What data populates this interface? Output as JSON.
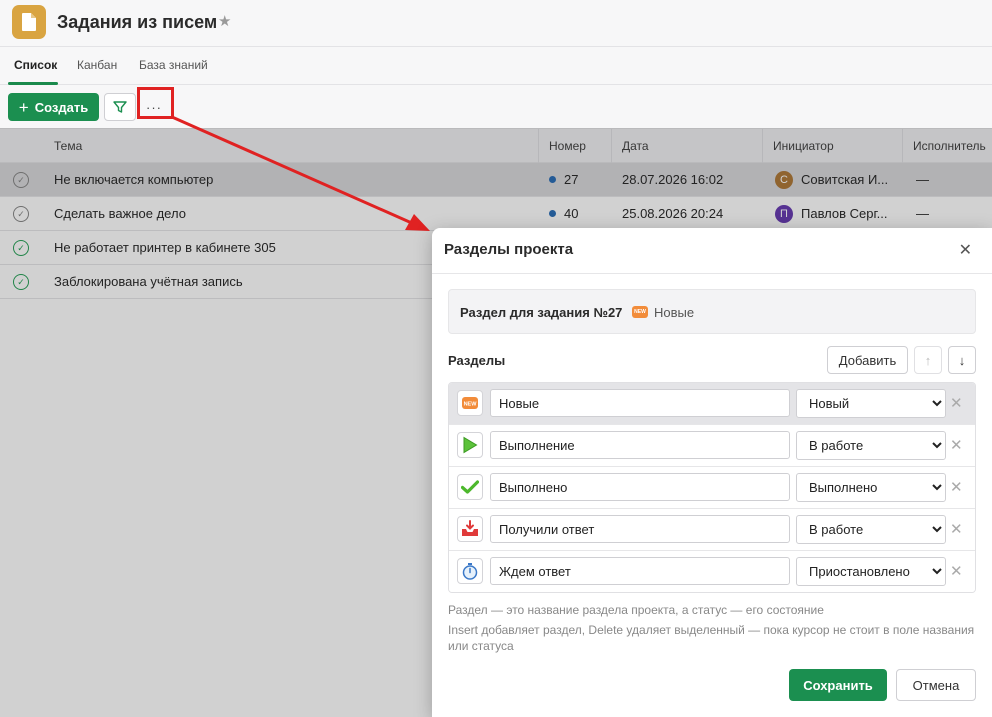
{
  "header": {
    "title": "Задания из писем"
  },
  "tabs": [
    {
      "label": "Список",
      "active": true
    },
    {
      "label": "Канбан",
      "active": false
    },
    {
      "label": "База знаний",
      "active": false
    }
  ],
  "toolbar": {
    "create_label": "Создать",
    "more_label": "···"
  },
  "table": {
    "columns": [
      "Тема",
      "Номер",
      "Дата",
      "Инициатор",
      "Исполнитель"
    ],
    "rows": [
      {
        "topic": "Не включается компьютер",
        "number": "27",
        "date": "28.07.2026 16:02",
        "initiator": "Совитская И...",
        "initiator_initial": "С",
        "initiator_color": "#b07a3a",
        "executor": "—",
        "done": false,
        "selected": true
      },
      {
        "topic": "Сделать важное дело",
        "number": "40",
        "date": "25.08.2026 20:24",
        "initiator": "Павлов Серг...",
        "initiator_initial": "П",
        "initiator_color": "#6a3db3",
        "executor": "—",
        "done": false,
        "selected": false
      },
      {
        "topic": "Не работает принтер в кабинете 305",
        "done": true,
        "selected": false
      },
      {
        "topic": "Заблокирована учётная запись",
        "done": true,
        "selected": false
      }
    ]
  },
  "dialog": {
    "title": "Разделы проекта",
    "section_for_task_label": "Раздел для задания №27",
    "section_for_task_value": "Новые",
    "sections_label": "Разделы",
    "add_label": "Добавить",
    "up_label": "↑",
    "down_label": "↓",
    "sections": [
      {
        "icon": "new-badge-icon",
        "name": "Новые",
        "status": "Новый",
        "selected": true
      },
      {
        "icon": "play-icon",
        "name": "Выполнение",
        "status": "В работе",
        "selected": false
      },
      {
        "icon": "checkmark-icon",
        "name": "Выполнено",
        "status": "Выполнено",
        "selected": false
      },
      {
        "icon": "inbox-download-icon",
        "name": "Получили ответ",
        "status": "В работе",
        "selected": false
      },
      {
        "icon": "stopwatch-icon",
        "name": "Ждем ответ",
        "status": "Приостановлено",
        "selected": false
      }
    ],
    "status_options": [
      "Новый",
      "В работе",
      "Выполнено",
      "Приостановлено"
    ],
    "hint_1": "Раздел — это название раздела проекта, а статус — его состояние",
    "hint_2": "Insert добавляет раздел, Delete удаляет выделенный — пока курсор не стоит в поле названия или статуса",
    "save_label": "Сохранить",
    "cancel_label": "Отмена"
  },
  "colors": {
    "accent": "#1b8f50",
    "annotation": "#e02222"
  }
}
